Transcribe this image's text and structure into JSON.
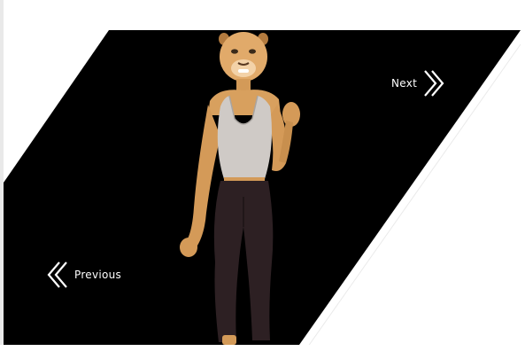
{
  "slider": {
    "next_label": "Next",
    "previous_label": "Previous",
    "next_icon": "double-chevron-right-icon",
    "previous_icon": "double-chevron-left-icon",
    "colors": {
      "slide_bg": "#000000",
      "page_bg": "#ffffff",
      "nav_text": "#ffffff"
    }
  }
}
